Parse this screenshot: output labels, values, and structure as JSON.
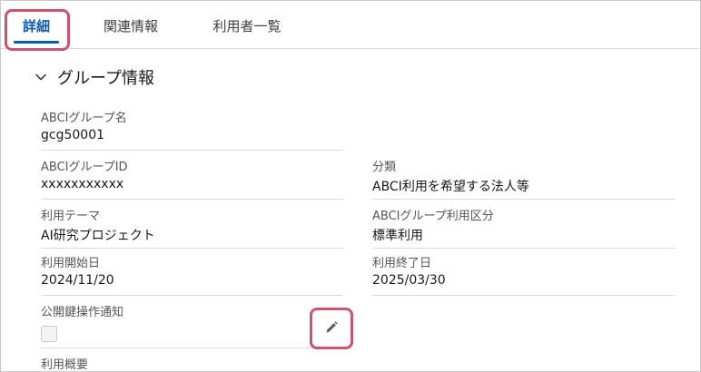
{
  "tabs": [
    {
      "label": "詳細",
      "active": true
    },
    {
      "label": "関連情報",
      "active": false
    },
    {
      "label": "利用者一覧",
      "active": false
    }
  ],
  "section": {
    "title": "グループ情報",
    "icon": "chevron-down-icon"
  },
  "fields": {
    "group_name": {
      "label": "ABCIグループ名",
      "value": "gcg50001"
    },
    "group_id": {
      "label": "ABCIグループID",
      "value": "xxxxxxxxxxx"
    },
    "category": {
      "label": "分類",
      "value": "ABCI利用を希望する法人等"
    },
    "theme": {
      "label": "利用テーマ",
      "value": "AI研究プロジェクト"
    },
    "usage_class": {
      "label": "ABCIグループ利用区分",
      "value": "標準利用"
    },
    "start_date": {
      "label": "利用開始日",
      "value": "2024/11/20"
    },
    "end_date": {
      "label": "利用終了日",
      "value": "2025/03/30"
    },
    "notify": {
      "label": "公開鍵操作通知",
      "checked": false
    },
    "summary": {
      "label": "利用概要"
    }
  },
  "colors": {
    "accent": "#0b5cab",
    "highlight": "#c8556b"
  },
  "icons": {
    "edit": "pencil-icon"
  }
}
